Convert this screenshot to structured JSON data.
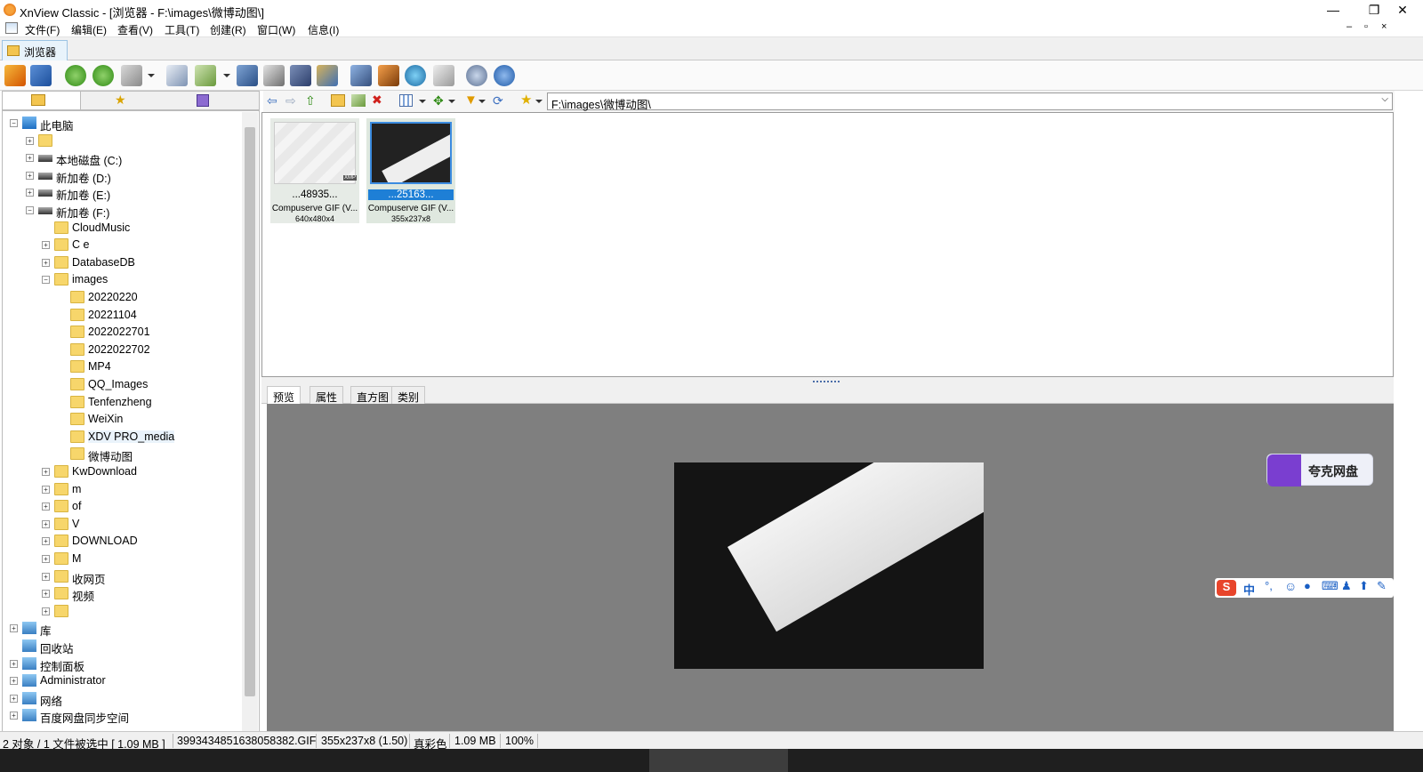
{
  "window": {
    "title": "XnView Classic - [浏览器 - F:\\images\\微博动图\\]",
    "minimize": "—",
    "restore": "❐",
    "close": "✕"
  },
  "menu": [
    "文件(F)",
    "编辑(E)",
    "查看(V)",
    "工具(T)",
    "创建(R)",
    "窗口(W)",
    "信息(I)"
  ],
  "tab": {
    "label": "浏览器"
  },
  "address": {
    "value": "F:\\images\\微博动图\\"
  },
  "tree": {
    "root": "此电脑",
    "nodes": [
      {
        "label": "",
        "exp": "+"
      },
      {
        "label": "本地磁盘 (C:)",
        "exp": "+"
      },
      {
        "label": "新加卷 (D:)",
        "exp": "+"
      },
      {
        "label": "新加卷 (E:)",
        "exp": "+"
      },
      {
        "label": "新加卷 (F:)",
        "exp": "−"
      },
      {
        "label": "CloudMusic",
        "exp": ""
      },
      {
        "label": "C  e",
        "exp": "+"
      },
      {
        "label": "DatabaseDB",
        "exp": "+"
      },
      {
        "label": "images",
        "exp": "−"
      },
      {
        "label": "20220220",
        "exp": ""
      },
      {
        "label": "20221104",
        "exp": ""
      },
      {
        "label": "2022022701",
        "exp": ""
      },
      {
        "label": "2022022702",
        "exp": ""
      },
      {
        "label": "MP4",
        "exp": ""
      },
      {
        "label": "QQ_Images",
        "exp": ""
      },
      {
        "label": "Tenfenzheng",
        "exp": ""
      },
      {
        "label": "WeiXin",
        "exp": ""
      },
      {
        "label": "XDV PRO_media",
        "exp": ""
      },
      {
        "label": "微博动图",
        "exp": ""
      },
      {
        "label": "KwDownload",
        "exp": "+"
      },
      {
        "label": "m",
        "exp": "+"
      },
      {
        "label": "of",
        "exp": "+"
      },
      {
        "label": "V",
        "exp": "+"
      },
      {
        "label": "DOWNLOAD",
        "exp": "+"
      },
      {
        "label": "M",
        "exp": "+"
      },
      {
        "label": "收网页",
        "exp": "+"
      },
      {
        "label": "视频",
        "exp": "+"
      },
      {
        "label": "",
        "exp": "+"
      },
      {
        "label": "库",
        "exp": "+"
      },
      {
        "label": "回收站",
        "exp": ""
      },
      {
        "label": "控制面板",
        "exp": "+"
      },
      {
        "label": "Administrator",
        "exp": "+"
      },
      {
        "label": "网络",
        "exp": "+"
      },
      {
        "label": "百度网盘同步空间",
        "exp": "+"
      }
    ]
  },
  "thumbnails": [
    {
      "name": "...48935...",
      "format": "Compuserve GIF (V...",
      "dims": "640x480x4",
      "badge": "XMP"
    },
    {
      "name": "...25163...",
      "format": "Compuserve GIF (V...",
      "dims": "355x237x8"
    }
  ],
  "preview_tabs": [
    "预览",
    "属性",
    "直方图",
    "类别"
  ],
  "overlay": {
    "quark": "夸克网盘",
    "ime": "中"
  },
  "status": [
    "2 对象 / 1 文件被选中  [ 1.09 MB ]",
    "3993434851638058382.GIF",
    "355x237x8 (1.50)",
    "真彩色",
    "1.09 MB",
    "100%"
  ],
  "colors": {
    "selection": "#1e7fd6",
    "preview_bg": "#7f7f7f",
    "folder": "#f7d66b"
  }
}
